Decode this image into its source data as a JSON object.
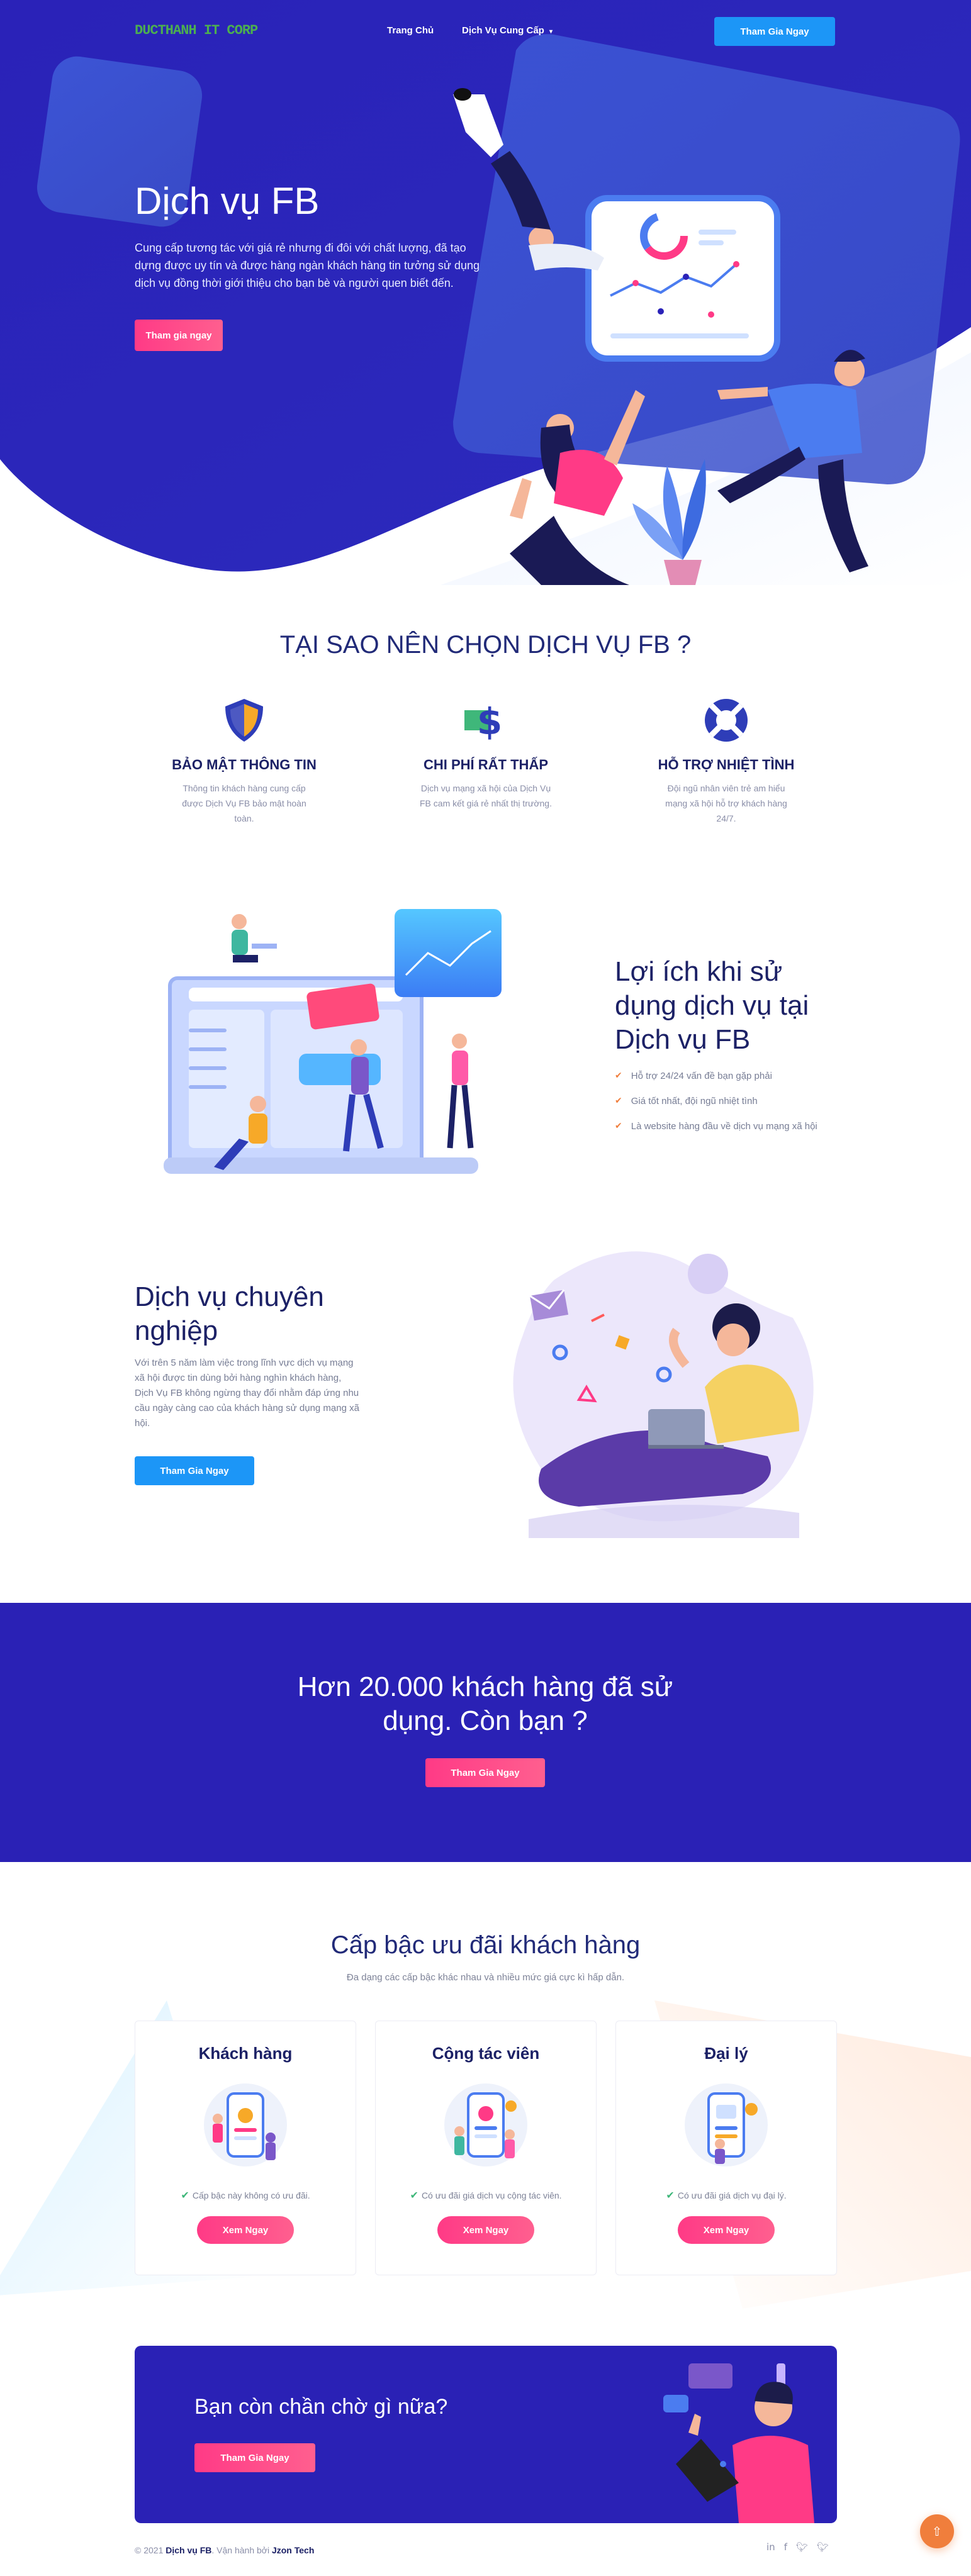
{
  "nav": {
    "logo": "DUCTHANH IT CORP",
    "home": "Trang Chủ",
    "services": "Dịch Vụ Cung Cấp",
    "cta": "Tham Gia Ngay"
  },
  "hero": {
    "title": "Dịch vụ FB",
    "desc": "Cung cấp tương tác với giá rẻ nhưng đi đôi với chất lượng, đã tạo dựng được uy tín và được hàng ngàn khách hàng tin tưởng sử dụng dịch vụ đồng thời giới thiệu cho bạn bè và người quen biết đến.",
    "cta": "Tham gia ngay"
  },
  "why": {
    "title": "TẠI SAO NÊN CHỌN DỊCH VỤ FB ?",
    "features": [
      {
        "icon": "shield-icon",
        "title": "BẢO MẬT THÔNG TIN",
        "desc": "Thông tin khách hàng cung cấp được Dịch Vụ FB bảo mật hoàn toàn."
      },
      {
        "icon": "dollar-icon",
        "title": "CHI PHÍ RẤT THẤP",
        "desc": "Dịch vụ mạng xã hội của Dịch Vụ FB cam kết giá rẻ nhất thị trường."
      },
      {
        "icon": "lifebuoy-icon",
        "title": "HỖ TRỢ NHIỆT TÌNH",
        "desc": "Đội ngũ nhân viên trẻ am hiểu mạng xã hội hỗ trợ khách hàng 24/7."
      }
    ]
  },
  "benefits": {
    "title": "Lợi ích khi sử dụng dịch vụ tại Dịch vụ FB",
    "items": [
      "Hỗ trợ 24/24 vấn đề bạn gặp phải",
      "Giá tốt nhất, đội ngũ nhiệt tình",
      "Là website hàng đầu về dịch vụ mạng xã hội"
    ]
  },
  "pro": {
    "title": "Dịch vụ chuyên nghiệp",
    "desc": "Với trên 5 năm làm việc trong lĩnh vực dịch vụ mạng xã hội được tin dùng bởi hàng nghìn khách hàng, Dịch Vụ FB không ngừng thay đổi nhằm đáp ứng nhu cầu ngày càng cao của khách hàng sử dụng mạng xã hội.",
    "cta": "Tham Gia Ngay"
  },
  "banner": {
    "title": "Hơn 20.000 khách hàng đã sử dụng. Còn bạn ?",
    "cta": "Tham Gia Ngay"
  },
  "tiers": {
    "title": "Cấp bậc ưu đãi khách hàng",
    "subtitle": "Đa dạng các cấp bậc khác nhau và nhiều mức giá cực kì hấp dẫn.",
    "cards": [
      {
        "title": "Khách hàng",
        "desc": "Cấp bậc này không có ưu đãi.",
        "cta": "Xem Ngay"
      },
      {
        "title": "Cộng tác viên",
        "desc": "Có ưu đãi giá dịch vụ cộng tác viên.",
        "cta": "Xem Ngay"
      },
      {
        "title": "Đại lý",
        "desc": "Có ưu đãi giá dịch vụ đại lý.",
        "cta": "Xem Ngay"
      }
    ]
  },
  "callout": {
    "title": "Bạn còn chần chờ gì nữa?",
    "cta": "Tham Gia Ngay"
  },
  "footer": {
    "prefix": "© 2021",
    "brand": "Dịch vụ FB",
    "mid": ". Vận hành bởi",
    "operator": "Jzon Tech",
    "social": [
      "linkedin-icon",
      "facebook-icon",
      "twitter-icon",
      "twitter-icon"
    ]
  },
  "colors": {
    "primary": "#2a21b5",
    "pink": "#ff3a86",
    "blue": "#1c96f7",
    "orange": "#f07e3c"
  }
}
